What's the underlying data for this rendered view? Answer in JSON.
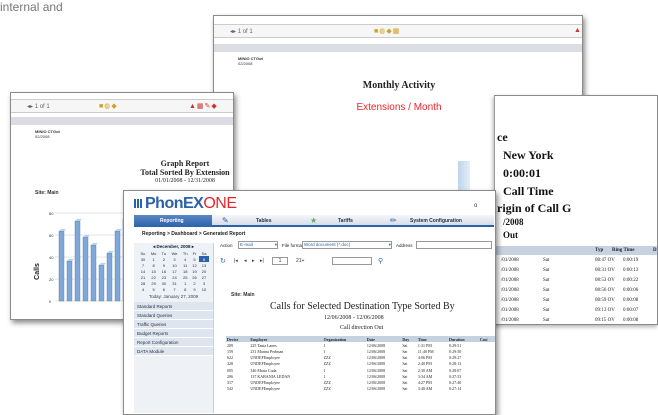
{
  "corner_text": "internal and",
  "page_back": {
    "toolbar_page": "1 of 1",
    "org": "MINIO CTGot",
    "org_date": "02/2008",
    "title": "Monthly Activity",
    "subtitle": "Extensions / Month"
  },
  "page_mid": {
    "toolbar_page": "1 of 1",
    "org": "MINIO CTGot",
    "org_date": "02/2008",
    "title": "Graph Report",
    "subtitle": "Total Sorted By Extension",
    "date_range": "01/01/2008 - 12/31/2008",
    "site": "Site: Main",
    "y_axis": "Calls"
  },
  "page_right": {
    "lines": [
      "ce",
      "New York",
      "0:00:01",
      "Call Time",
      "rigin of Call G",
      "/2008",
      "Out"
    ],
    "headers": [
      "Typ",
      "Ring Time",
      "D"
    ],
    "rows": [
      {
        "date": "/01/2008",
        "day": "Sat",
        "time": "08:47 OV",
        "ring": "0:00:19"
      },
      {
        "date": "/01/2008",
        "day": "Sat",
        "time": "08:31 OV",
        "ring": "0:00:13"
      },
      {
        "date": "/01/2008",
        "day": "Sat",
        "time": "08:53 OV",
        "ring": "0:00:22"
      },
      {
        "date": "/01/2008",
        "day": "Sat",
        "time": "08:56 OV",
        "ring": "0:00:06"
      },
      {
        "date": "/01/2008",
        "day": "Sat",
        "time": "08:59 OV",
        "ring": "0:00:08"
      },
      {
        "date": "/01/2008",
        "day": "Sat",
        "time": "09:13 OV",
        "ring": "0:00:07"
      },
      {
        "date": "/01/2008",
        "day": "Sat",
        "time": "09:15 OV",
        "ring": "0:00:08"
      }
    ]
  },
  "app": {
    "logo": "PhonEX",
    "logo_accent": "ONE",
    "tabs": [
      "Reporting",
      "Tables",
      "Tariffs",
      "System Configuration"
    ],
    "breadcrumb": "Reporting > Dashboard > Generated Report",
    "action_label": "Action",
    "action_value": "E-mail",
    "format_label": "File format",
    "format_value": "Word document (*.doc)",
    "address_label": "Address",
    "pager_page": "1",
    "pager_total": "21+",
    "calendar": {
      "month": "December, 2008",
      "days": [
        "Su",
        "Mo",
        "Tu",
        "We",
        "Th",
        "Fr",
        "Sa"
      ],
      "weeks": [
        [
          "30",
          "1",
          "2",
          "3",
          "4",
          "5",
          "6"
        ],
        [
          "7",
          "8",
          "9",
          "10",
          "11",
          "12",
          "13"
        ],
        [
          "14",
          "15",
          "16",
          "17",
          "18",
          "19",
          "20"
        ],
        [
          "21",
          "22",
          "23",
          "24",
          "25",
          "26",
          "27"
        ],
        [
          "28",
          "29",
          "30",
          "31",
          "1",
          "2",
          "3"
        ],
        [
          "4",
          "5",
          "6",
          "7",
          "8",
          "9",
          "10"
        ]
      ],
      "today": "Today: January 27, 2009"
    },
    "nav": [
      "Standard Reports",
      "Standard Queries",
      "Traffic Queries",
      "Budget Reports",
      "Report Configuration",
      "DATA Module"
    ],
    "site": "Site: Main",
    "report_title": "Calls for Selected Destination Type Sorted By",
    "report_range": "12/06/2008 - 12/06/2008",
    "report_direction": "Call direction Out",
    "table_headers": [
      "Device",
      "Employee",
      "Organization",
      "Date",
      "Day",
      "Time",
      "Duration",
      "Cost"
    ],
    "table_rows": [
      [
        "209",
        "225 Tania Lanes",
        "1",
        "12/06/2008",
        "Sat",
        "1:31 PM",
        "0:29:51",
        ""
      ],
      [
        "159",
        "231 Marina Perlman",
        "1",
        "12/06/2008",
        "Sat",
        "11:40 PM",
        "0:29:50",
        ""
      ],
      [
        "622",
        "UNDEFEmployee",
        "ZZZ",
        "12/06/2008",
        "Sat",
        "4:06 PM",
        "0:29:27",
        ""
      ],
      [
        "328",
        "UNDEFEmployee",
        "ZZZ",
        "12/06/2008",
        "Sat",
        "2:40 PM",
        "0:28:13",
        ""
      ],
      [
        "005",
        "346 Maria Cuda",
        "1",
        "12/06/2008",
        "Sat",
        "2:30 AM",
        "0:28:07",
        ""
      ],
      [
        "206",
        "137 KABANIA LEDAN",
        "1",
        "12/06/2008",
        "Sat",
        "3:34 AM",
        "0:27:53",
        ""
      ],
      [
        "317",
        "UNDEFEmployee",
        "ZZZ",
        "12/06/2008",
        "Sat",
        "4:27 PM",
        "0:27:40",
        ""
      ],
      [
        "542",
        "UNDEFEmployee",
        "ZZZ",
        "12/06/2008",
        "Sat",
        "3:40 AM",
        "0:27:14",
        ""
      ]
    ]
  },
  "colors": {
    "accent_red": "#e8252b",
    "header_blue": "#2b62a9",
    "bar_blue": "#7fa8d8",
    "nav_bg": "#dfe5ef"
  }
}
